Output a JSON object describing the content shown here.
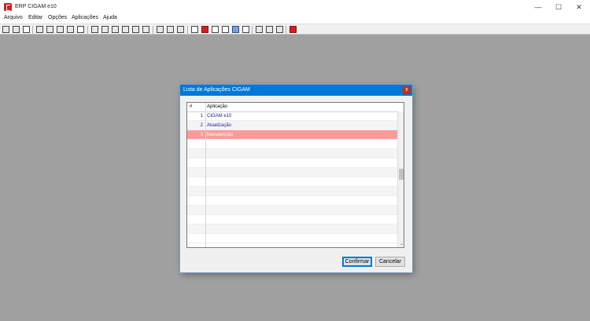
{
  "window": {
    "title": "ERP CIGAM e10",
    "minimize_glyph": "—",
    "maximize_glyph": "☐",
    "close_glyph": "✕"
  },
  "menu": [
    {
      "label": "Arquivo"
    },
    {
      "label": "Editar"
    },
    {
      "label": "Opções"
    },
    {
      "label": "Aplicações"
    },
    {
      "label": "Ajuda"
    }
  ],
  "toolbar": {
    "icons": [
      "open-folder-icon",
      "open-icon",
      "window-icon",
      "chart-icon",
      "chart-2-icon",
      "monitor-icon",
      "report-icon",
      "document-icon",
      "copy-window-icon",
      "paste-window-icon",
      "edit-icon",
      "pin-icon",
      "grid-icon",
      "sort-icon",
      "cascade-icon",
      "tile-icon",
      "print-icon",
      "form-icon",
      "form-red-icon",
      "form-2-icon",
      "form-3-icon",
      "form-4-icon",
      "form-5-icon",
      "cut-icon",
      "copy-icon",
      "paste-icon",
      "cigam-logo-icon"
    ]
  },
  "dialog": {
    "title": "Lista de Aplicações CIGAM",
    "close_glyph": "x",
    "columns": {
      "num": "#",
      "app": "Aplicação"
    },
    "rows": [
      {
        "num": "1",
        "app": "CIGAM e10",
        "selected": false
      },
      {
        "num": "2",
        "app": "Atualização",
        "selected": false
      },
      {
        "num": "3",
        "app": "Manutenção",
        "selected": true
      }
    ],
    "confirm_label": "Confirmar",
    "cancel_label": "Cancelar",
    "scroll_down_glyph": "⌄"
  },
  "colors": {
    "selected_row": "#ff9a9a",
    "title_bar": "#0078d7",
    "link_text": "#1a1a8c"
  }
}
